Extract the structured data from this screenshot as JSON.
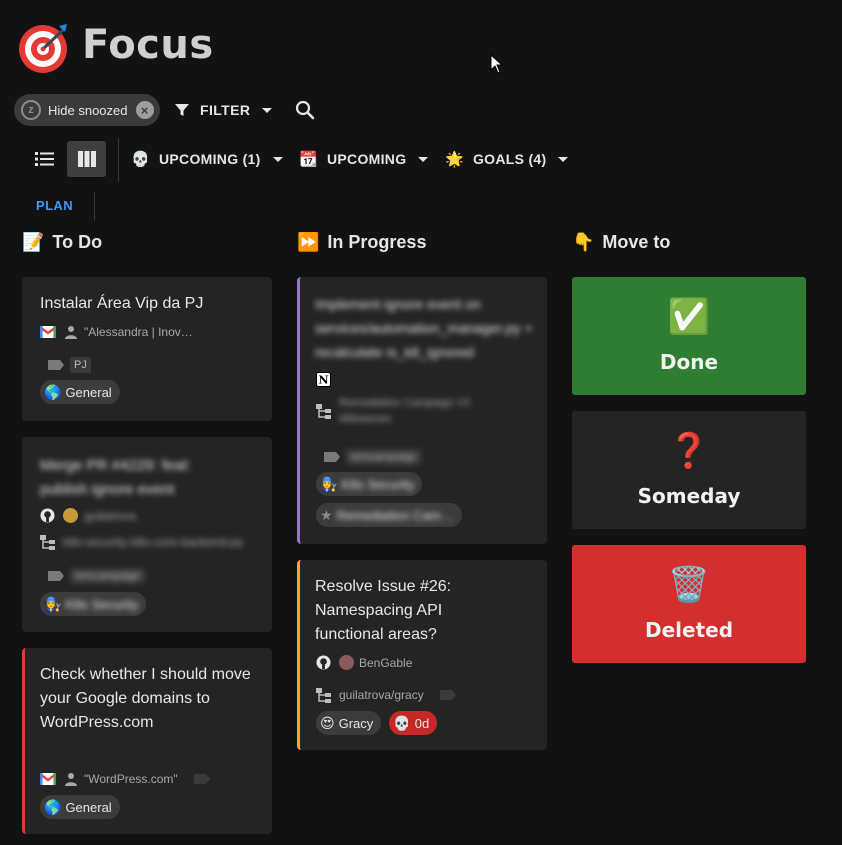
{
  "header": {
    "title": "Focus"
  },
  "filters": {
    "snooze_chip": "Hide snoozed",
    "filter_label": "FILTER"
  },
  "views": {
    "menus": [
      {
        "emoji": "💀",
        "label": "UPCOMING (1)"
      },
      {
        "emoji": "📆",
        "label": "UPCOMING"
      },
      {
        "emoji": "🌟",
        "label": "GOALS (4)"
      }
    ],
    "plan_label": "PLAN"
  },
  "columns": {
    "todo": {
      "emoji": "📝",
      "title": "To Do",
      "cards": [
        {
          "title": "Instalar Área Vip da PJ",
          "sender": "\"Alessandra | Inov…",
          "tag": "PJ",
          "goal_emoji": "🌎",
          "goal": "General"
        },
        {
          "title": "Merge PR #4229: feat: publish ignore event",
          "author": "guilatrova",
          "repo": "k8s-security-k8s-core-backend-py",
          "tag": "remcampaign",
          "goal_emoji": "👩‍🔧",
          "goal": "K8s Security"
        },
        {
          "title": "Check whether I should move your Google domains to WordPress.com",
          "sender": "\"WordPress.com\"",
          "goal_emoji": "🌎",
          "goal": "General"
        }
      ]
    },
    "progress": {
      "emoji": "⏩",
      "title": "In Progress",
      "cards": [
        {
          "title": "Implement ignore event on services/automation_manager.py + recalculate is_k8_ignored",
          "project": "Remediation Campaign V2 Milestones",
          "tag": "remcampaign",
          "goal_emoji": "👩‍🔧",
          "goal": "K8s Security",
          "subgoal": "Remediation Cam…"
        },
        {
          "title": "Resolve Issue #26: Namespacing API functional areas?",
          "author": "BenGable",
          "repo": "guilatrova/gracy",
          "goal_emoji": "😍",
          "goal": "Gracy",
          "due_emoji": "💀",
          "due": "0d"
        }
      ]
    },
    "move": {
      "emoji": "👇",
      "title": "Move to",
      "targets": [
        {
          "emoji": "✅",
          "label": "Done",
          "color": "#2e7d32"
        },
        {
          "emoji": "❓",
          "label": "Someday",
          "color": "#242424"
        },
        {
          "emoji": "🗑️",
          "label": "Deleted",
          "color": "#d32f2f"
        }
      ]
    }
  },
  "colors": {
    "accent": "#3f9bf0",
    "purple_border": "#9575cd",
    "orange_border": "#f9a825",
    "red_border": "#e53935"
  }
}
